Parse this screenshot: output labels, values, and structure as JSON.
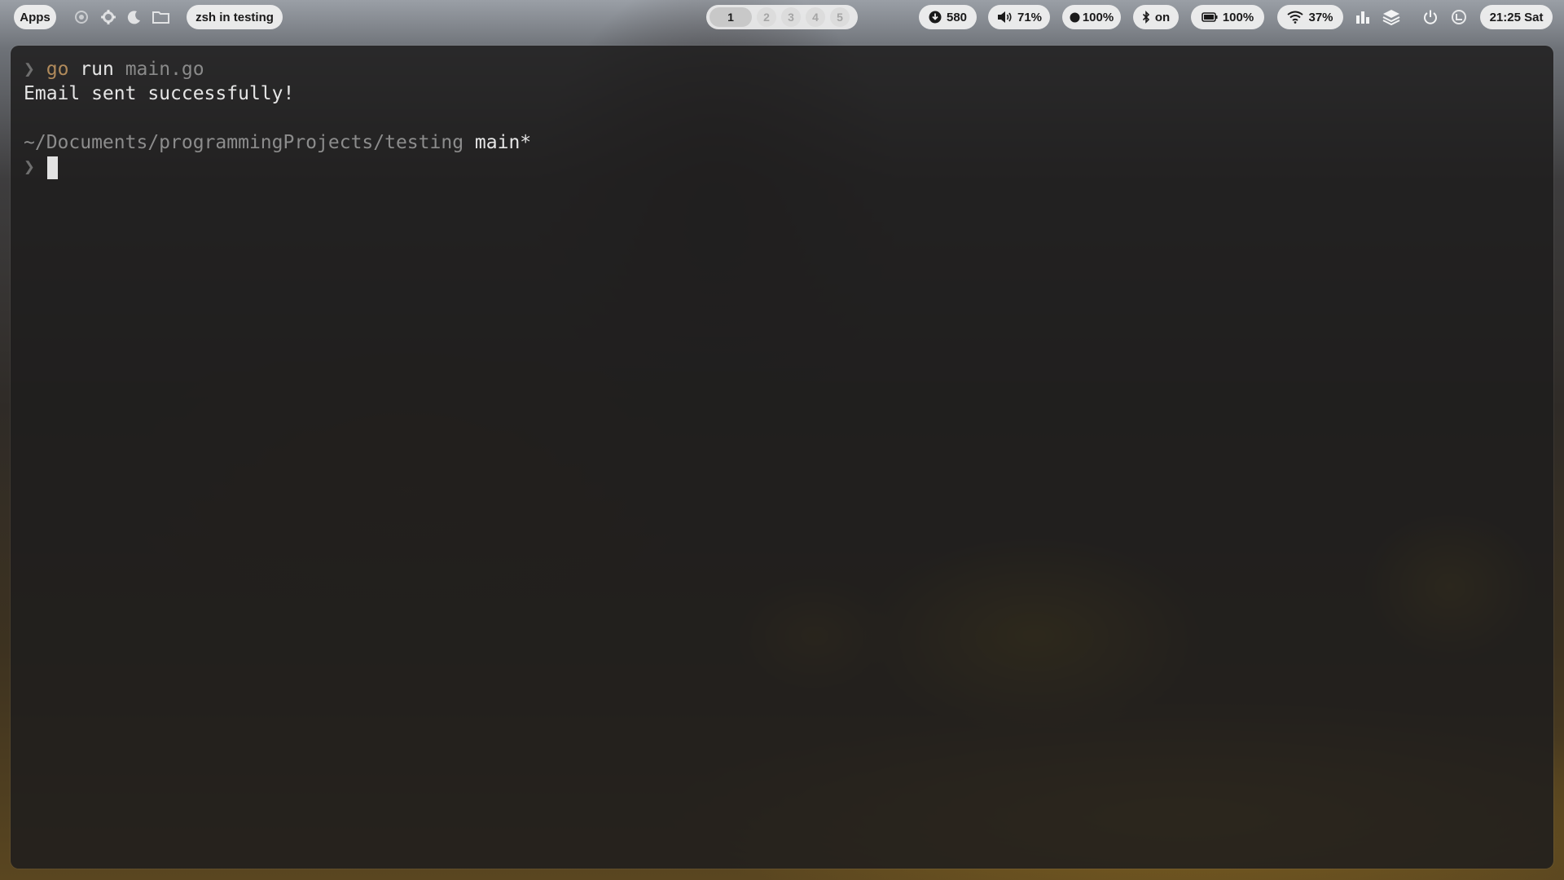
{
  "topbar": {
    "apps_label": "Apps",
    "window_title": "zsh in testing",
    "workspaces": [
      "1",
      "2",
      "3",
      "4",
      "5"
    ],
    "active_workspace": "1",
    "updates": "580",
    "volume": "71%",
    "brightness": "100%",
    "bluetooth": "on",
    "battery": "100%",
    "wifi": "37%",
    "clock": "21:25 Sat",
    "icons": [
      "screenshot-icon",
      "settings-icon",
      "moon-icon",
      "folder-icon",
      "download-icon",
      "speaker-icon",
      "circle-icon",
      "bluetooth-icon",
      "battery-icon",
      "wifi-icon",
      "bar-chart-icon",
      "layers-icon",
      "power-icon",
      "calendar-icon"
    ]
  },
  "terminal": {
    "prompt_symbol": "❯",
    "command_go": "go",
    "command_run": "run",
    "command_arg": "main.go",
    "output": "Email sent successfully!",
    "cwd": "~/Documents/programmingProjects/testing",
    "branch": "main*"
  }
}
